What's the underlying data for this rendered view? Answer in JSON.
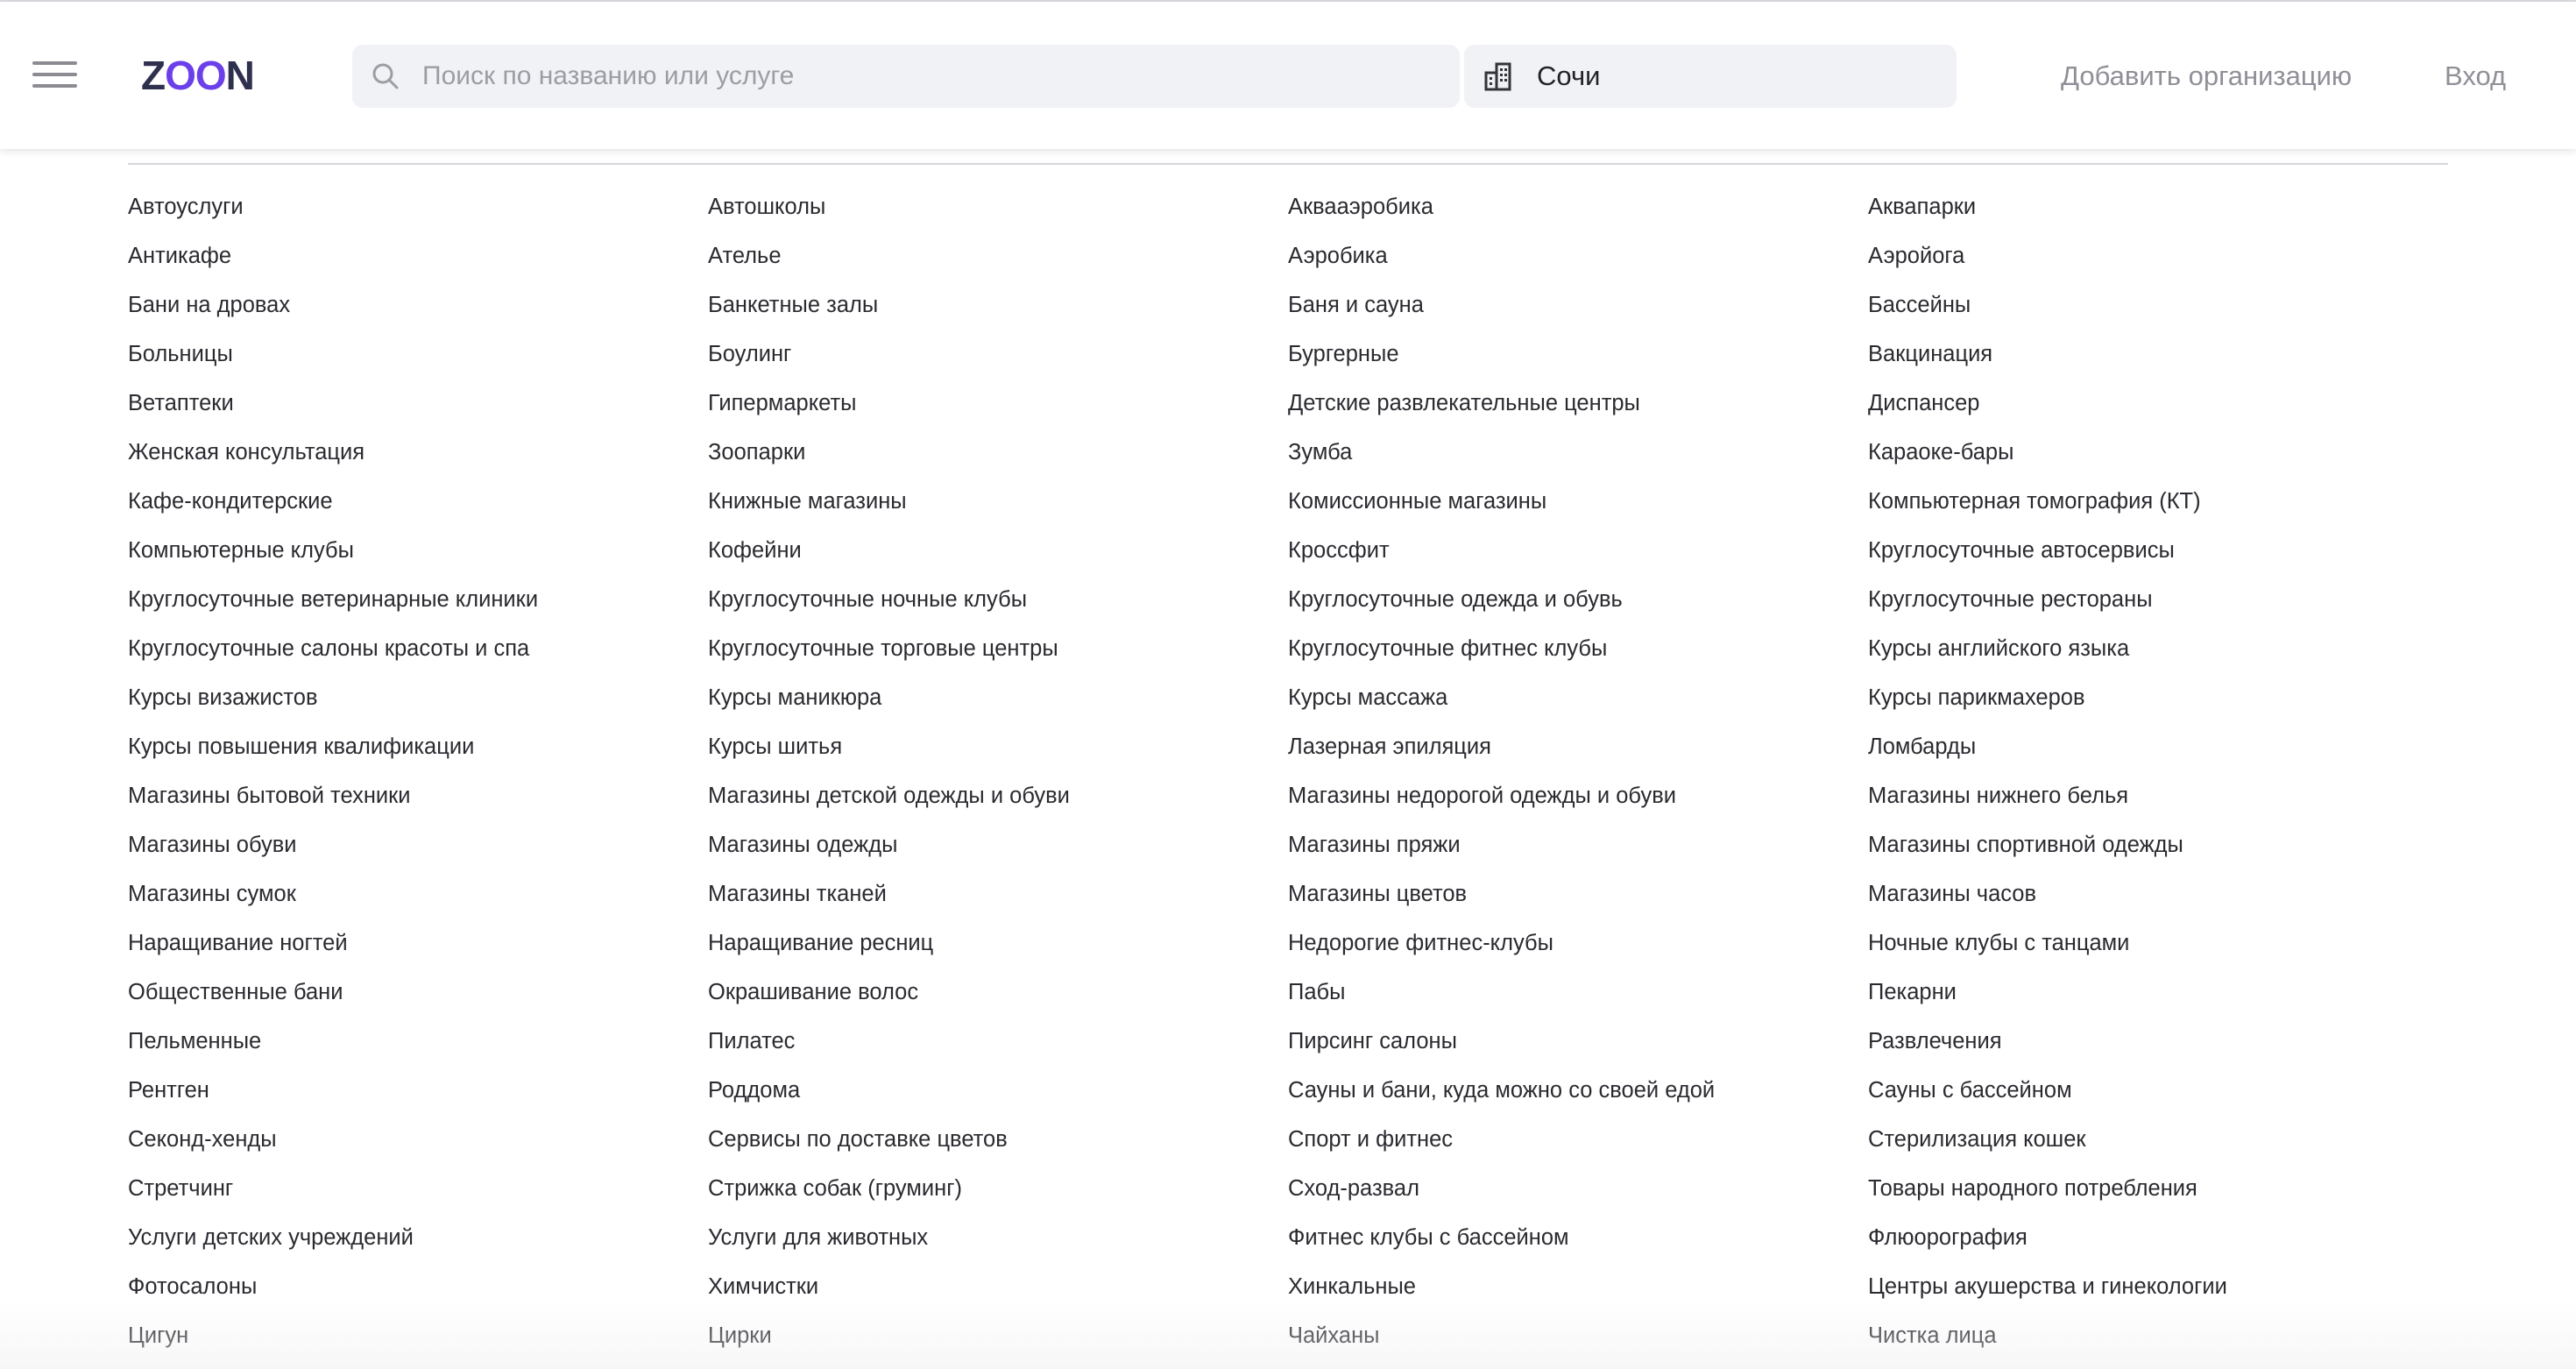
{
  "header": {
    "logo_text_start": "Z",
    "logo_text_accent": "OO",
    "logo_text_end": "N",
    "search_placeholder": "Поиск по названию или услуге",
    "city": "Сочи",
    "add_org_label": "Добавить организацию",
    "login_label": "Вход",
    "icons": [
      "menu-icon",
      "search-icon",
      "city-icon"
    ],
    "brand_accent_color": "#6b3fea",
    "brand_dark_color": "#2f2f4e"
  },
  "categories": [
    "Автоуслуги",
    "Автошколы",
    "Аквааэробика",
    "Аквапарки",
    "Антикафе",
    "Ателье",
    "Аэробика",
    "Аэройога",
    "Бани на дровах",
    "Банкетные залы",
    "Баня и сауна",
    "Бассейны",
    "Больницы",
    "Боулинг",
    "Бургерные",
    "Вакцинация",
    "Ветаптеки",
    "Гипермаркеты",
    "Детские развлекательные центры",
    "Диспансер",
    "Женская консультация",
    "Зоопарки",
    "Зумба",
    "Караоке-бары",
    "Кафе-кондитерские",
    "Книжные магазины",
    "Комиссионные магазины",
    "Компьютерная томография (КТ)",
    "Компьютерные клубы",
    "Кофейни",
    "Кроссфит",
    "Круглосуточные автосервисы",
    "Круглосуточные ветеринарные клиники",
    "Круглосуточные ночные клубы",
    "Круглосуточные одежда и обувь",
    "Круглосуточные рестораны",
    "Круглосуточные салоны красоты и спа",
    "Круглосуточные торговые центры",
    "Круглосуточные фитнес клубы",
    "Курсы английского языка",
    "Курсы визажистов",
    "Курсы маникюра",
    "Курсы массажа",
    "Курсы парикмахеров",
    "Курсы повышения квалификации",
    "Курсы шитья",
    "Лазерная эпиляция",
    "Ломбарды",
    "Магазины бытовой техники",
    "Магазины детской одежды и обуви",
    "Магазины недорогой одежды и обуви",
    "Магазины нижнего белья",
    "Магазины обуви",
    "Магазины одежды",
    "Магазины пряжи",
    "Магазины спортивной одежды",
    "Магазины сумок",
    "Магазины тканей",
    "Магазины цветов",
    "Магазины часов",
    "Наращивание ногтей",
    "Наращивание ресниц",
    "Недорогие фитнес-клубы",
    "Ночные клубы с танцами",
    "Общественные бани",
    "Окрашивание волос",
    "Пабы",
    "Пекарни",
    "Пельменные",
    "Пилатес",
    "Пирсинг салоны",
    "Развлечения",
    "Рентген",
    "Роддома",
    "Сауны и бани, куда можно со своей едой",
    "Сауны с бассейном",
    "Секонд-хенды",
    "Сервисы по доставке цветов",
    "Спорт и фитнес",
    "Стерилизация кошек",
    "Стретчинг",
    "Стрижка собак (груминг)",
    "Сход-развал",
    "Товары народного потребления",
    "Услуги детских учреждений",
    "Услуги для животных",
    "Фитнес клубы с бассейном",
    "Флюорография",
    "Фотосалоны",
    "Химчистки",
    "Хинкальные",
    "Центры акушерства и гинекологии",
    "Цигун",
    "Цирки",
    "Чайханы",
    "Чистка лица"
  ]
}
